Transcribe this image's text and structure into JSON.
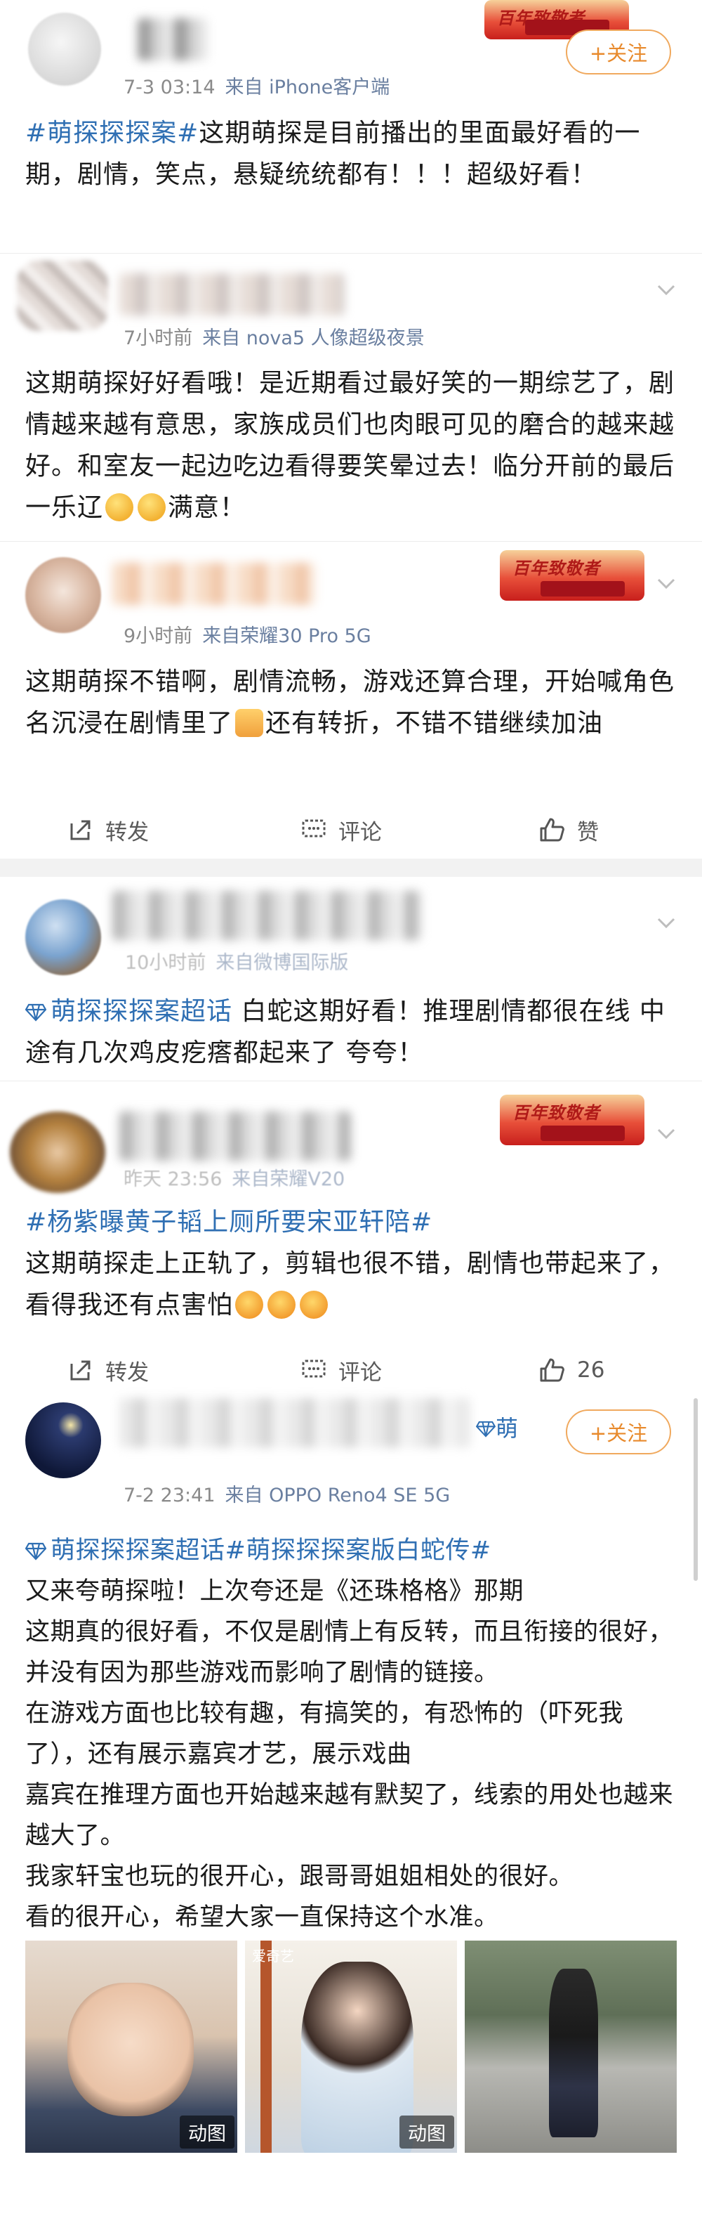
{
  "post1": {
    "meta_time": "7-3 03:14",
    "meta_source": "来自 iPhone客户端",
    "follow_label": "+关注",
    "badge_text": "百年致敬者",
    "text_tag": "#萌探探探案#",
    "text_body": "这期萌探是目前播出的里面最好看的一期，剧情，笑点，悬疑统统都有！！！超级好看！"
  },
  "comment1": {
    "meta_time": "7小时前",
    "meta_source": "来自 nova5 人像超级夜景",
    "text_body": "这期萌探好好看哦！是近期看过最好笑的一期综艺了，剧情越来越有意思，家族成员们也肉眼可见的磨合的越来越好。和室友一起边吃边看得要笑晕过去！临分开前的最后一乐辽",
    "text_end": "满意！",
    "emoji": [
      "cry-laugh-emoji",
      "cry-laugh-emoji"
    ]
  },
  "comment2": {
    "meta_time": "9小时前",
    "meta_source": "来自荣耀30 Pro 5G",
    "badge_text": "百年致敬者",
    "text_body_1": "这期萌探不错啊，剧情流畅，游戏还算合理，开始喊角色名沉浸在剧情里了",
    "text_body_2": "还有转折，不错不错继续加油"
  },
  "actions1": {
    "repost": "转发",
    "comment": "评论",
    "like": "赞"
  },
  "post2": {
    "meta_time": "10小时前",
    "meta_source": "来自微博国际版",
    "text_tag": "萌探探探案超话",
    "text_body": " 白蛇这期好看！推理剧情都很在线 中途有几次鸡皮疙瘩都起来了 夸夸！"
  },
  "post3": {
    "meta_time": "昨天 23:56",
    "meta_source": "来自荣耀V20",
    "badge_text": "百年致敬者",
    "text_tag": "#杨紫曝黄子韬上厕所要宋亚轩陪#",
    "text_body": "这期萌探走上正轨了，剪辑也很不错，剧情也带起来了，看得我还有点害怕"
  },
  "actions2": {
    "repost": "转发",
    "comment": "评论",
    "like_count": "26"
  },
  "post4": {
    "meta_time": "7-2 23:41",
    "meta_source": "来自 OPPO Reno4 SE 5G",
    "follow_label": "+关注",
    "name_suffix": "萌",
    "text_tag": "萌探探探案超话#萌探探探案版白蛇传#",
    "lines": [
      "又来夸萌探啦！上次夸还是《还珠格格》那期",
      "这期真的很好看，不仅是剧情上有反转，而且衔接的很好，并没有因为那些游戏而影响了剧情的链接。",
      "在游戏方面也比较有趣，有搞笑的，有恐怖的（吓死我了），还有展示嘉宾才艺，展示戏曲",
      "嘉宾在推理方面也开始越来越有默契了，线索的用处也越来越大了。",
      "我家轩宝也玩的很开心，跟哥哥姐姐相处的很好。",
      "看的很开心，希望大家一直保持这个水准。"
    ],
    "gif_label": "动图",
    "watermark": "爱奇艺"
  },
  "colors": {
    "link": "#2f6fb3",
    "meta": "#8a8a8a",
    "follow": "#e88a2c",
    "divider": "#f2f2f2"
  }
}
